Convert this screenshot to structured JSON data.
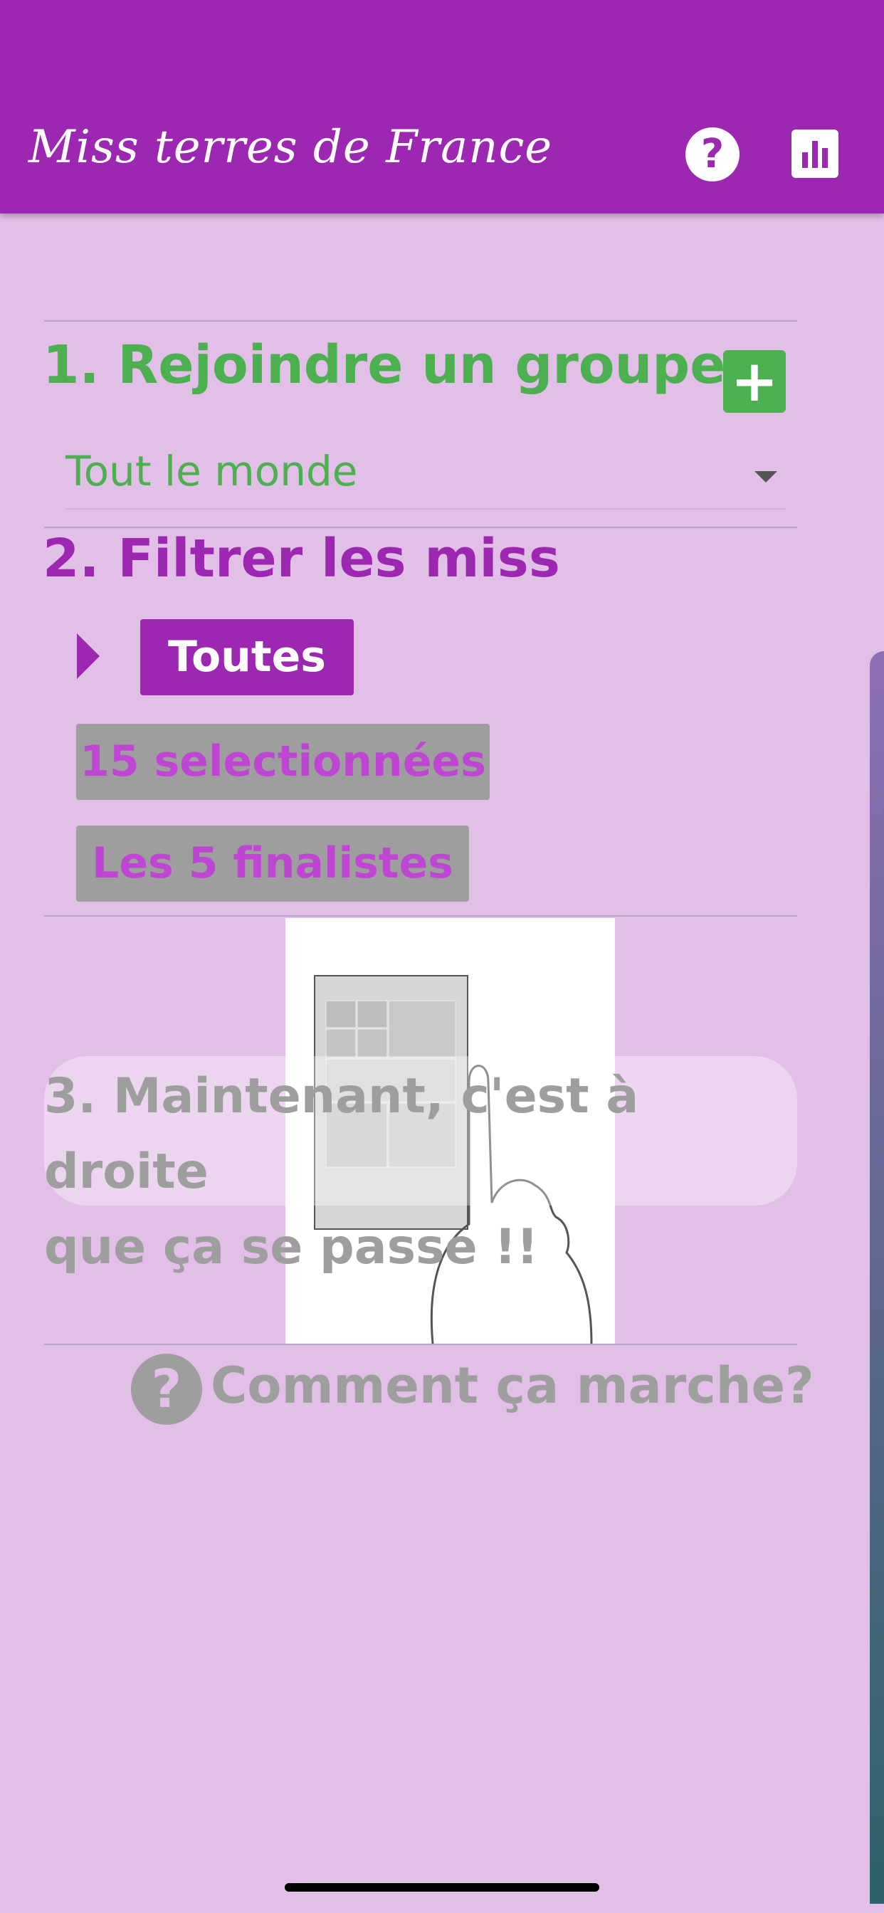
{
  "app_title": "Miss terres de France",
  "header": {
    "help_icon": "question-circle-icon",
    "stats_icon": "bar-chart-icon"
  },
  "step1": {
    "title": "1. Rejoindre un groupe",
    "add_label": "+",
    "group_selected": "Tout le monde"
  },
  "step2": {
    "title": "2. Filtrer les miss",
    "filters": [
      "Toutes",
      "15 selectionnées",
      "Les 5 finalistes"
    ],
    "selected_filter": "Toutes"
  },
  "step3": {
    "line1": "3. Maintenant, c'est à droite",
    "line2": "que ça se passe !!"
  },
  "help_link": {
    "icon_glyph": "?",
    "label": "Comment ça marche?"
  },
  "colors": {
    "primary": "#9c27b0",
    "green": "#4caf50",
    "background": "#e1bfe6",
    "muted": "#9e9e9e"
  }
}
